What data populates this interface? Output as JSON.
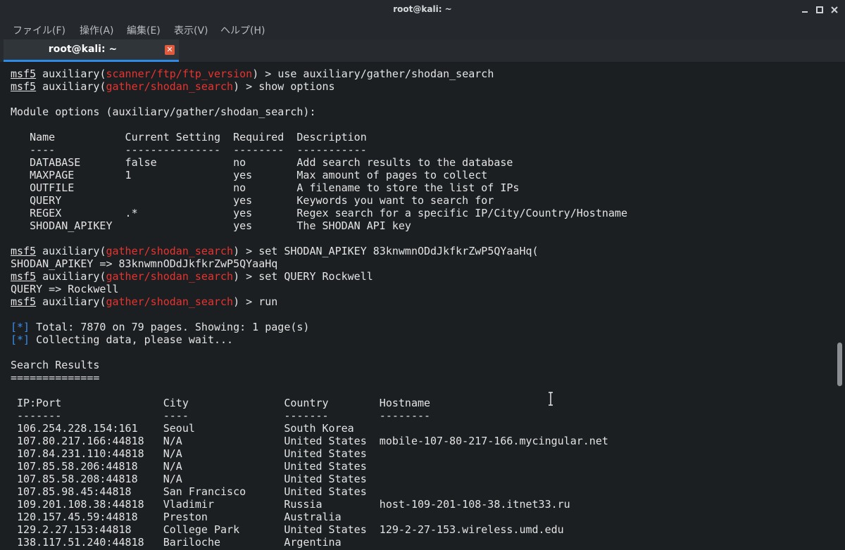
{
  "window": {
    "title": "root@kali: ~",
    "controls": [
      "minimize-icon",
      "maximize-icon",
      "close-icon"
    ]
  },
  "menu": {
    "file": "ファイル(F)",
    "action": "操作(A)",
    "edit": "編集(E)",
    "view": "表示(V)",
    "help": "ヘルプ(H)"
  },
  "tab": {
    "label": "root@kali: ~",
    "close_icon": "close-icon"
  },
  "terminal": {
    "prompt": "msf5",
    "module_label": "auxiliary",
    "cmd1": {
      "module": "scanner/ftp/ftp_version",
      "command": "use auxiliary/gather/shodan_search"
    },
    "cmd2": {
      "module": "gather/shodan_search",
      "command": "show options"
    },
    "module_options_heading": "Module options (auxiliary/gather/shodan_search):",
    "options_headers": [
      "Name",
      "Current Setting",
      "Required",
      "Description"
    ],
    "options_separators": [
      "----",
      "---------------",
      "--------",
      "-----------"
    ],
    "options": [
      [
        "DATABASE",
        "false",
        "no",
        "Add search results to the database"
      ],
      [
        "MAXPAGE",
        "1",
        "yes",
        "Max amount of pages to collect"
      ],
      [
        "OUTFILE",
        "",
        "no",
        "A filename to store the list of IPs"
      ],
      [
        "QUERY",
        "",
        "yes",
        "Keywords you want to search for"
      ],
      [
        "REGEX",
        ".*",
        "yes",
        "Regex search for a specific IP/City/Country/Hostname"
      ],
      [
        "SHODAN_APIKEY",
        "",
        "yes",
        "The SHODAN API key"
      ]
    ],
    "cmd3": {
      "module": "gather/shodan_search",
      "command": "set SHODAN_APIKEY 83knwmnODdJkfkrZwP5QYaaHq("
    },
    "out3": "SHODAN_APIKEY => 83knwmnODdJkfkrZwP5QYaaHq",
    "cmd4": {
      "module": "gather/shodan_search",
      "command": "set QUERY Rockwell"
    },
    "out4": "QUERY => Rockwell",
    "cmd5": {
      "module": "gather/shodan_search",
      "command": "run"
    },
    "status_marker": "[*]",
    "status1": "Total: 7870 on 79 pages. Showing: 1 page(s)",
    "status2": "Collecting data, please wait...",
    "results_heading": "Search Results",
    "results_underline": "==============",
    "results_headers": [
      "IP:Port",
      "City",
      "Country",
      "Hostname"
    ],
    "results_separators": [
      "-------",
      "----",
      "-------",
      "--------"
    ],
    "results": [
      [
        "106.254.228.154:161",
        "Seoul",
        "South Korea",
        ""
      ],
      [
        "107.80.217.166:44818",
        "N/A",
        "United States",
        "mobile-107-80-217-166.mycingular.net"
      ],
      [
        "107.84.231.110:44818",
        "N/A",
        "United States",
        ""
      ],
      [
        "107.85.58.206:44818",
        "N/A",
        "United States",
        ""
      ],
      [
        "107.85.58.208:44818",
        "N/A",
        "United States",
        ""
      ],
      [
        "107.85.98.45:44818",
        "San Francisco",
        "United States",
        ""
      ],
      [
        "109.201.108.38:44818",
        "Vladimir",
        "Russia",
        "host-109-201-108-38.itnet33.ru"
      ],
      [
        "120.157.45.59:44818",
        "Preston",
        "Australia",
        ""
      ],
      [
        "129.2.27.153:44818",
        "College Park",
        "United States",
        "129-2-27-153.wireless.umd.edu"
      ],
      [
        "138.117.51.240:44818",
        "Bariloche",
        "Argentina",
        ""
      ]
    ]
  },
  "scrollbar": {
    "position": 0.78
  },
  "colors": {
    "highlight_red": "#e8332f",
    "info_blue": "#3a8ee6",
    "tab_accent": "#2d8ae6"
  }
}
